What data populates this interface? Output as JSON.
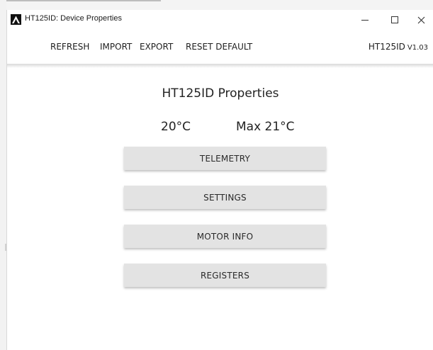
{
  "window": {
    "title": "HT125ID: Device Properties",
    "minimize_glyph": "—",
    "close_glyph": "✕"
  },
  "menu": {
    "refresh": "REFRESH",
    "import": "IMPORT",
    "export": "EXPORT",
    "reset_default": "RESET DEFAULT"
  },
  "device": {
    "name": "HT125ID",
    "version": "V1.03"
  },
  "main": {
    "title": "HT125ID Properties",
    "temperature": "20°C",
    "max_temperature": "Max 21°C",
    "buttons": {
      "telemetry": "TELEMETRY",
      "settings": "SETTINGS",
      "motor_info": "MOTOR INFO",
      "registers": "REGISTERS"
    }
  },
  "icons": {
    "app": "app-logo-icon",
    "minimize": "minimize-icon",
    "maximize": "maximize-icon",
    "close": "close-icon"
  },
  "colors": {
    "button_bg": "#e3e3e3",
    "window_bg": "#ffffff",
    "text": "#1e1e1e"
  }
}
